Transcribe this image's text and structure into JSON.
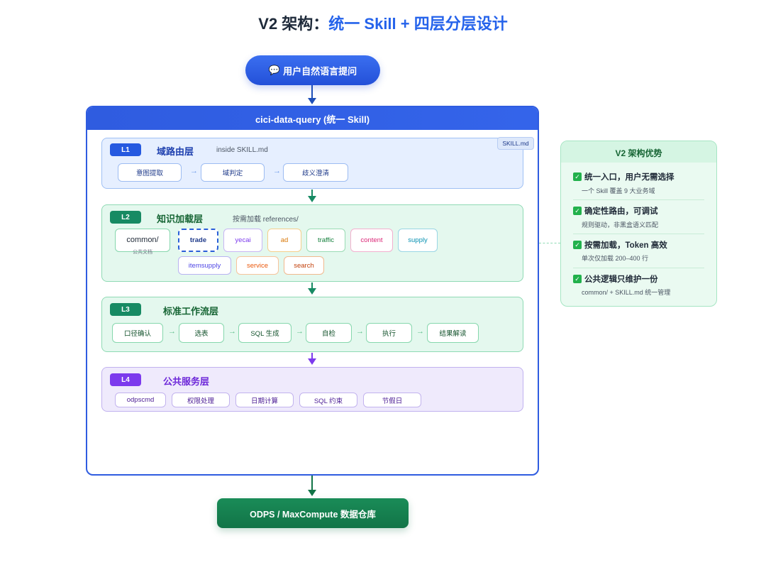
{
  "title": {
    "prefix": "V2 架构：",
    "accent": "统一 Skill + 四层分层设计"
  },
  "entry": {
    "icon": "speech-bubble-icon",
    "label": "用户自然语言提问"
  },
  "skill": {
    "header": "cici-data-query (统一 Skill)",
    "tag": "SKILL.md"
  },
  "l1": {
    "badge": "L1",
    "title": "域路由层",
    "sub": "inside SKILL.md",
    "nodes": [
      "意图提取",
      "域判定",
      "歧义澄清"
    ]
  },
  "l2": {
    "badge": "L2",
    "title": "知识加载层",
    "sub": "按需加载 references/",
    "common": {
      "label": "common/",
      "sub": "公共文档"
    },
    "row1": [
      "trade",
      "yecai",
      "ad",
      "traffic",
      "content",
      "supply"
    ],
    "row2": [
      "itemsupply",
      "service",
      "search"
    ]
  },
  "l3": {
    "badge": "L3",
    "title": "标准工作流层",
    "nodes": [
      "口径确认",
      "选表",
      "SQL 生成",
      "自检",
      "执行",
      "结果解读"
    ]
  },
  "l4": {
    "badge": "L4",
    "title": "公共服务层",
    "nodes": [
      "odpscmd",
      "权限处理",
      "日期计算",
      "SQL 约束",
      "节假日"
    ]
  },
  "advantages": {
    "title": "V2 架构优势",
    "items": [
      {
        "title": "统一入口，用户无需选择",
        "desc": "一个 Skill 覆盖 9 大业务域"
      },
      {
        "title": "确定性路由，可调试",
        "desc": "规则驱动，非黑盒语义匹配"
      },
      {
        "title": "按需加载，Token 高效",
        "desc": "单次仅加载 200–400 行"
      },
      {
        "title": "公共逻辑只维护一份",
        "desc": "common/ + SKILL.md 统一管理"
      }
    ]
  },
  "storage": {
    "label": "ODPS / MaxCompute 数据仓库"
  },
  "colors": {
    "primary": "#2f5ce0",
    "l1": "#2559e0",
    "l2": "#178a63",
    "l3": "#178a63",
    "l4": "#7c3aed",
    "trade": "#2a5fd8",
    "yecai": "#7c3aed",
    "ad": "#d97706",
    "traffic": "#15803d",
    "content": "#db2777",
    "supply": "#0891b2",
    "itemsupply": "#4f46e5",
    "service": "#ea580c",
    "search": "#c2410c"
  }
}
